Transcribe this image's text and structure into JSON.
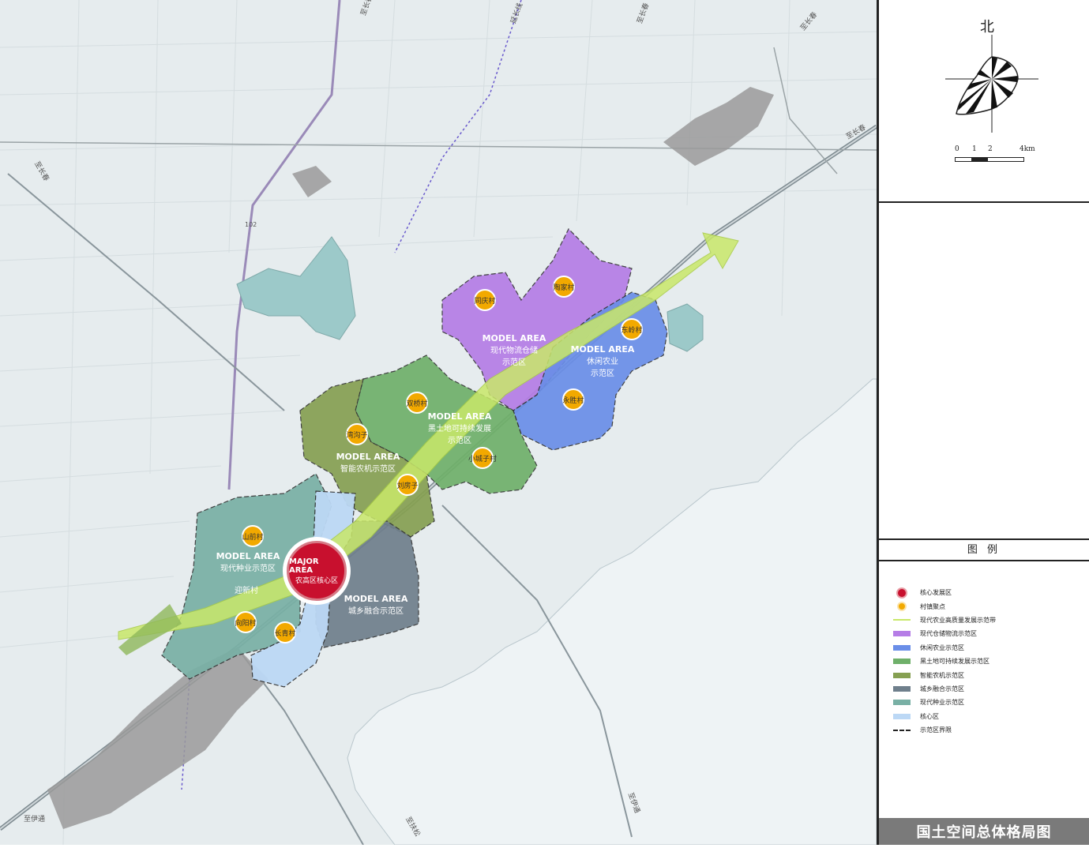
{
  "map": {
    "road_labels": [
      "至长春",
      "延长线",
      "至长春",
      "至长春",
      "102",
      "至伊通",
      "至长春",
      "至长春",
      "至伊通",
      "至扶松"
    ],
    "villages": [
      "同庆村",
      "陶家村",
      "东岭村",
      "永胜村",
      "双桥村",
      "湾沟子",
      "小城子村",
      "刘房子",
      "山前村",
      "迎新村",
      "向阳村",
      "长青村"
    ],
    "zones": [
      {
        "en": "MODEL AREA",
        "zh": [
          "现代物流仓储",
          "示范区"
        ]
      },
      {
        "en": "MODEL AREA",
        "zh": [
          "休闲农业",
          "示范区"
        ]
      },
      {
        "en": "MODEL AREA",
        "zh": [
          "黑土地可持续发展",
          "示范区"
        ]
      },
      {
        "en": "MODEL AREA",
        "zh": [
          "智能农机示范区"
        ]
      },
      {
        "en": "MODEL AREA",
        "zh": [
          "现代种业示范区"
        ]
      },
      {
        "en": "MODEL AREA",
        "zh": [
          "城乡融合示范区"
        ]
      }
    ],
    "core": {
      "en": "MAJOR AREA",
      "zh": "农高区核心区"
    }
  },
  "north": {
    "label": "北"
  },
  "scale": {
    "ticks": [
      "0",
      "1",
      "2",
      "4km"
    ]
  },
  "legend": {
    "title": "图 例",
    "items": [
      {
        "label": "核心发展区",
        "symbol": "red-dot-icon",
        "color": "#c8102e"
      },
      {
        "label": "村镇聚点",
        "symbol": "yellow-dot-icon",
        "color": "#f2a900"
      },
      {
        "label": "现代农业高质量发展示范带",
        "symbol": "arrow-line-icon",
        "color": "#c9e86a"
      },
      {
        "label": "现代仓储物流示范区",
        "symbol": "swatch",
        "color": "#b57de6"
      },
      {
        "label": "休闲农业示范区",
        "symbol": "swatch",
        "color": "#6a8ee8"
      },
      {
        "label": "黑土地可持续发展示范区",
        "symbol": "swatch",
        "color": "#6fb06a"
      },
      {
        "label": "智能农机示范区",
        "symbol": "swatch",
        "color": "#86a052"
      },
      {
        "label": "城乡融合示范区",
        "symbol": "swatch",
        "color": "#6f7f8c"
      },
      {
        "label": "现代种业示范区",
        "symbol": "swatch",
        "color": "#79b0a5"
      },
      {
        "label": "核心区",
        "symbol": "swatch",
        "color": "#bcd8f5"
      },
      {
        "label": "示范区界限",
        "symbol": "dash-line-icon",
        "color": "#222222"
      }
    ]
  },
  "footer": {
    "title": "国土空间总体格局图"
  },
  "colors": {
    "map_bg": "#e8eef0",
    "water": "#ecf2f4",
    "reservoir": "#9cc9c9"
  }
}
